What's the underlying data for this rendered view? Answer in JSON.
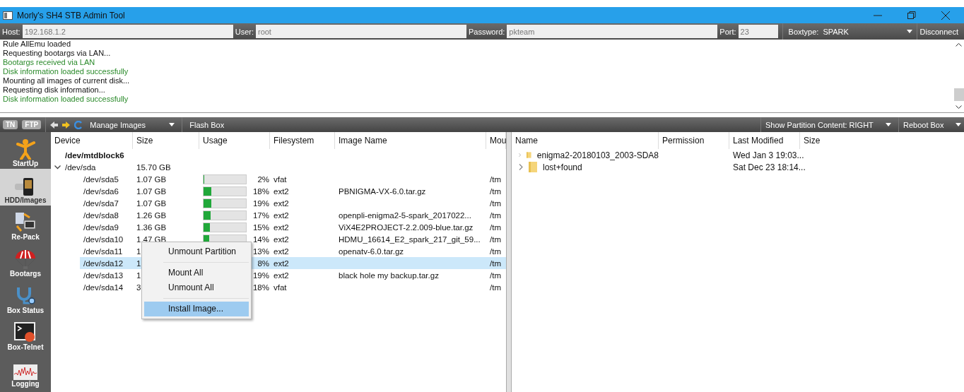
{
  "window": {
    "title": "Morly's SH4 STB Admin Tool"
  },
  "connection": {
    "fields": [
      {
        "label": "Host:",
        "value": "192.168.1.2"
      },
      {
        "label": "User:",
        "value": "root"
      },
      {
        "label": "Password:",
        "value": "pkteam"
      },
      {
        "label": "Port:",
        "value": "23"
      }
    ],
    "boxtype": {
      "label": "Boxtype:",
      "value": "SPARK"
    },
    "disconnect": "Disconnect"
  },
  "log": [
    {
      "text": "Rule AllEmu loaded",
      "kind": "info"
    },
    {
      "text": "Requesting bootargs via LAN...",
      "kind": "info"
    },
    {
      "text": "Bootargs received via LAN",
      "kind": "success"
    },
    {
      "text": "Disk information loaded successfully",
      "kind": "success"
    },
    {
      "text": "Mounting all images of current disk...",
      "kind": "info"
    },
    {
      "text": "Requesting disk information...",
      "kind": "info"
    },
    {
      "text": "Disk information loaded successfully",
      "kind": "success"
    }
  ],
  "toolbar": {
    "tn": "TN",
    "ftp": "FTP",
    "manage_images": "Manage Images",
    "flash_box": "Flash Box",
    "show_partition": "Show Partition Content: RIGHT",
    "reboot_box": "Reboot Box"
  },
  "sidebar": {
    "items": [
      {
        "label": "StartUp",
        "selected": false,
        "kind": "figure"
      },
      {
        "label": "HDD/Images",
        "selected": true,
        "kind": "hdd"
      },
      {
        "label": "Re-Pack",
        "selected": false,
        "kind": "repack"
      },
      {
        "label": "Bootargs",
        "selected": false,
        "kind": "parachute"
      },
      {
        "label": "Box Status",
        "selected": false,
        "kind": "stethoscope"
      },
      {
        "label": "Box-Telnet",
        "selected": false,
        "kind": "terminal"
      },
      {
        "label": "Logging",
        "selected": false,
        "kind": "wave"
      }
    ]
  },
  "devices": {
    "columns": [
      "Device",
      "Size",
      "Usage",
      "Filesystem",
      "Image Name",
      "Mou"
    ],
    "rows": [
      {
        "device": "/dev/mtdblock6",
        "bold": true
      },
      {
        "device": "/dev/sda",
        "size": "15.70 GB",
        "bold": false,
        "expanded": true,
        "children": [
          {
            "device": "/dev/sda5",
            "size": "1.07 GB",
            "level": 0.02,
            "usage": "2%",
            "filesystem": "vfat",
            "mount": "/tm",
            "selected": false
          },
          {
            "device": "/dev/sda6",
            "size": "1.07 GB",
            "level": 0.18,
            "usage": "18%",
            "filesystem": "ext2",
            "image_name": "PBNIGMA-VX-6.0.tar.gz",
            "mount": "/tm",
            "selected": false
          },
          {
            "device": "/dev/sda7",
            "size": "1.07 GB",
            "level": 0.19,
            "usage": "19%",
            "filesystem": "ext2",
            "mount": "/tm",
            "selected": false
          },
          {
            "device": "/dev/sda8",
            "size": "1.26 GB",
            "level": 0.17,
            "usage": "17%",
            "filesystem": "ext2",
            "image_name": "openpli-enigma2-5-spark_2017022...",
            "mount": "/tm",
            "selected": false
          },
          {
            "device": "/dev/sda9",
            "size": "1.36 GB",
            "level": 0.15,
            "usage": "15%",
            "filesystem": "ext2",
            "image_name": "ViX4E2PROJECT-2.2.009-blue.tar.gz",
            "mount": "/tm",
            "selected": false
          },
          {
            "device": "/dev/sda10",
            "size": "1.47 GB",
            "level": 0.14,
            "usage": "14%",
            "filesystem": "ext2",
            "image_name": "HDMU_16614_E2_spark_217_git_59...",
            "mount": "/tm",
            "selected": false
          },
          {
            "device": "/dev/sda11",
            "size": "1",
            "usage": "13%",
            "filesystem": "ext2",
            "image_name": "openatv-6.0.tar.gz",
            "mount": "/tm",
            "selected": false
          },
          {
            "device": "/dev/sda12",
            "size": "1",
            "usage": "8%",
            "filesystem": "ext2",
            "mount": "/tm",
            "selected": true
          },
          {
            "device": "/dev/sda13",
            "size": "1",
            "usage": "19%",
            "filesystem": "ext2",
            "image_name": "black hole my backup.tar.gz",
            "mount": "/tm",
            "selected": false
          },
          {
            "device": "/dev/sda14",
            "size": "3",
            "usage": "18%",
            "filesystem": "vfat",
            "mount": "/tm",
            "selected": false
          }
        ]
      }
    ]
  },
  "context_menu": {
    "items": [
      {
        "kind": "item",
        "label": "Unmount Partition",
        "selected": false
      },
      {
        "kind": "separator"
      },
      {
        "kind": "item",
        "label": "Mount All",
        "selected": false
      },
      {
        "kind": "item",
        "label": "Unmount All",
        "selected": false
      },
      {
        "kind": "separator"
      },
      {
        "kind": "item",
        "label": "Install Image...",
        "selected": true
      }
    ]
  },
  "files": {
    "columns": [
      "Name",
      "Permission",
      "Last Modified",
      "Size"
    ],
    "rows": [
      {
        "name": "enigma2-20180103_2003-SDA8",
        "modified": "Wed Jan 3 19:03...",
        "expanded": false
      },
      {
        "name": "lost+found",
        "modified": "Sat Dec 23 18:14...",
        "expanded": false
      }
    ]
  }
}
